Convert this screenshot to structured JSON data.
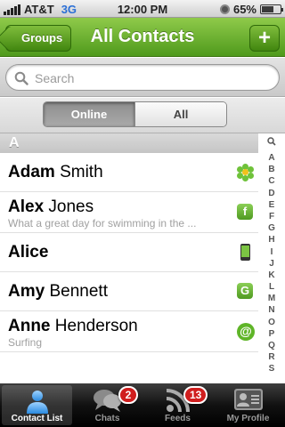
{
  "status_bar": {
    "carrier": "AT&T",
    "network": "3G",
    "time": "12:00 PM",
    "battery": "65%"
  },
  "navbar": {
    "back_label": "Groups",
    "title": "All Contacts",
    "add_label": "+"
  },
  "search": {
    "placeholder": "Search"
  },
  "segments": {
    "online": "Online",
    "all": "All",
    "selected": "Online"
  },
  "section": {
    "letter": "A"
  },
  "contacts": [
    {
      "first": "Adam",
      "last": "Smith",
      "status_text": "",
      "service": "icq"
    },
    {
      "first": "Alex",
      "last": "Jones",
      "status_text": "What a great day for swimming in the ...",
      "service": "facebook"
    },
    {
      "first": "Alice",
      "last": "",
      "status_text": "",
      "service": "mobile"
    },
    {
      "first": "Amy",
      "last": "Bennett",
      "status_text": "",
      "service": "gtalk"
    },
    {
      "first": "Anne",
      "last": "Henderson",
      "status_text": "Surfing",
      "service": "email"
    }
  ],
  "index": [
    "Q",
    "A",
    "B",
    "C",
    "D",
    "E",
    "F",
    "G",
    "H",
    "I",
    "J",
    "K",
    "L",
    "M",
    "N",
    "O",
    "P",
    "Q",
    "R",
    "S"
  ],
  "tabs": [
    {
      "label": "Contact List",
      "active": true,
      "badge": ""
    },
    {
      "label": "Chats",
      "active": false,
      "badge": "2"
    },
    {
      "label": "Feeds",
      "active": false,
      "badge": "13"
    },
    {
      "label": "My Profile",
      "active": false,
      "badge": ""
    }
  ],
  "colors": {
    "nav_green": "#5fa62a",
    "badge_red": "#d01e1e"
  }
}
